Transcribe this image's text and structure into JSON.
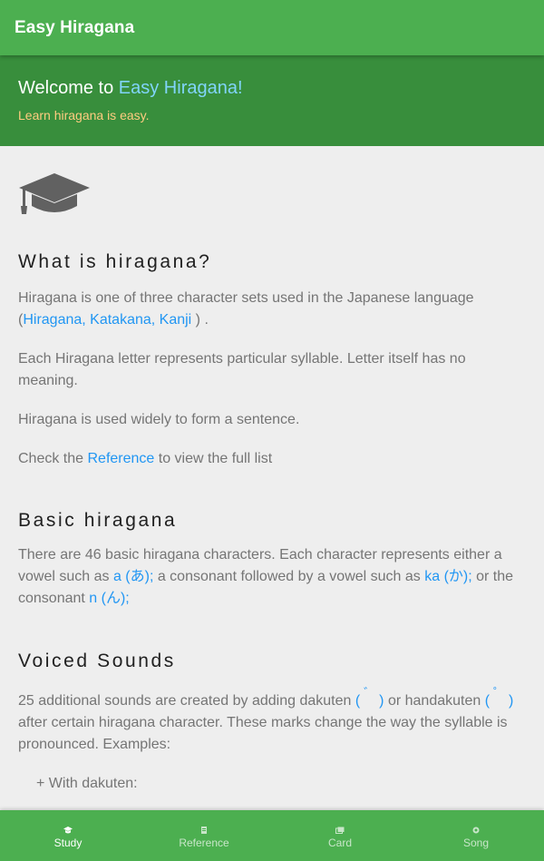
{
  "appbar": {
    "title": "Easy Hiragana"
  },
  "hero": {
    "title_prefix": "Welcome to ",
    "title_brand": "Easy Hiragana!",
    "subtitle": "Learn hiragana is easy."
  },
  "sections": {
    "what": {
      "heading": "What is hiragana?",
      "p1_text": "Hiragana is one of three character sets used in the Japanese language (",
      "p1_link": "Hiragana, Katakana, Kanji",
      "p1_end": " ) .",
      "p2": "Each Hiragana letter represents particular syllable. Letter itself has no meaning.",
      "p3": "Hiragana is used widely to form a sentence.",
      "p4_pre": "Check the ",
      "p4_link": "Reference",
      "p4_post": " to view the full list"
    },
    "basic": {
      "heading": "Basic hiragana",
      "text1": "There are 46 basic hiragana characters. Each character represents either a vowel such as ",
      "ex_a": "a (あ);",
      "text2": "  a consonant followed by a vowel such as ",
      "ex_ka": "ka (か);",
      "text3": " or the consonant ",
      "ex_n": "n (ん);"
    },
    "voiced": {
      "heading": "Voiced Sounds",
      "text1": "25 additional sounds are created by adding dakuten ",
      "dakuten_open": "(",
      "dakuten_mark": "゛",
      "dakuten_close": ")",
      "text2": " or handakuten ",
      "handakuten_open": "(",
      "handakuten_mark": "゜",
      "handakuten_close": ")",
      "text3": " after certain hiragana character. These marks change the way the syllable is pronounced. Examples:",
      "list_item": "+ With dakuten:"
    }
  },
  "bottom_nav": [
    {
      "label": "Study",
      "icon": "graduation-cap-icon",
      "active": true
    },
    {
      "label": "Reference",
      "icon": "book-icon",
      "active": false
    },
    {
      "label": "Card",
      "icon": "cards-icon",
      "active": false
    },
    {
      "label": "Song",
      "icon": "music-icon",
      "active": false
    }
  ],
  "colors": {
    "appbar": "#4caf50",
    "hero": "#388e3c",
    "brand": "#81d4fa",
    "subtitle": "#ffcc80",
    "link": "#2196f3"
  }
}
